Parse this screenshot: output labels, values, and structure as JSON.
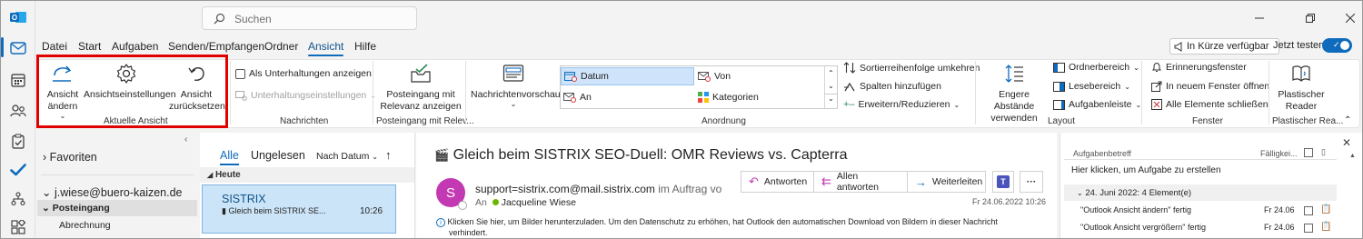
{
  "app": {
    "logo_letter": "O",
    "accent": "#0f6cbd",
    "highlight": "#e00000"
  },
  "search": {
    "placeholder": "Suchen"
  },
  "tabs": [
    "Datei",
    "Start",
    "Aufgaben",
    "Senden/Empfangen",
    "Ordner",
    "Ansicht",
    "Hilfe"
  ],
  "active_tab": "Ansicht",
  "topright": {
    "soon_label": "In Kürze verfügbar",
    "try_label": "Jetzt testen"
  },
  "ribbon": {
    "aktuelle_ansicht": {
      "change_view": "Ansicht ändern",
      "view_settings": "Ansichtseinstellungen",
      "reset_view_1": "Ansicht",
      "reset_view_2": "zurücksetzen",
      "label": "Aktuelle Ansicht"
    },
    "nachrichten": {
      "show_conversations": "Als Unterhaltungen anzeigen",
      "conversation_settings": "Unterhaltungseinstellungen",
      "label": "Nachrichten"
    },
    "relevance": {
      "line1": "Posteingang mit",
      "line2": "Relevanz anzeigen",
      "label": "Posteingang mit Relev..."
    },
    "anordnung": {
      "preview": "Nachrichtenvorschau",
      "datum": "Datum",
      "von": "Von",
      "an": "An",
      "kategorien": "Kategorien",
      "reverse": "Sortierreihenfolge umkehren",
      "add_columns": "Spalten hinzufügen",
      "expand": "Erweitern/Reduzieren",
      "label": "Anordnung"
    },
    "layout": {
      "spacing_1": "Engere Abstände",
      "spacing_2": "verwenden",
      "folder_pane": "Ordnerbereich",
      "reading_pane": "Lesebereich",
      "todo_bar": "Aufgabenleiste",
      "label": "Layout"
    },
    "fenster": {
      "reminders": "Erinnerungsfenster",
      "new_window": "In neuem Fenster öffnen",
      "close_all": "Alle Elemente schließen",
      "label": "Fenster"
    },
    "reader": {
      "line1": "Plastischer",
      "line2": "Reader",
      "label": "Plastischer Rea..."
    }
  },
  "folders": {
    "favorites": "Favoriten",
    "account": "j.wiese@buero-kaizen.de",
    "inbox": "Posteingang",
    "sub": "Abrechnung"
  },
  "list": {
    "tab_all": "Alle",
    "tab_unread": "Ungelesen",
    "sort": "Nach Datum",
    "group_today": "Heute",
    "item_sender": "SISTRIX",
    "item_subject": "Gleich beim SISTRIX SE...",
    "item_time": "10:26"
  },
  "message": {
    "subject": "Gleich beim SISTRIX SEO-Duell: OMR Reviews vs. Capterra",
    "avatar_letter": "S",
    "from": "support=sistrix.com@mail.sistrix.com",
    "on_behalf": "im Auftrag vo",
    "to_prefix": "An",
    "to": "Jacqueline Wiese",
    "date": "Fr 24.06.2022 10:26",
    "reply": "Antworten",
    "reply_all": "Allen antworten",
    "forward": "Weiterleiten",
    "info_line1": "Klicken Sie hier, um Bilder herunterzuladen. Um den Datenschutz zu erhöhen, hat Outlook den automatischen Download von Bildern in dieser Nachricht",
    "info_line2": "verhindert."
  },
  "todo": {
    "col_subject": "Aufgabenbetreff",
    "col_due": "Fälligkei...",
    "create": "Hier klicken, um Aufgabe zu erstellen",
    "group": "24. Juni 2022: 4 Element(e)",
    "items": [
      {
        "title": "\"Outlook Ansicht ändern\" fertig",
        "date": "Fr 24.06"
      },
      {
        "title": "\"Outlook Ansicht vergrößern\" fertig",
        "date": "Fr 24.06"
      }
    ]
  }
}
